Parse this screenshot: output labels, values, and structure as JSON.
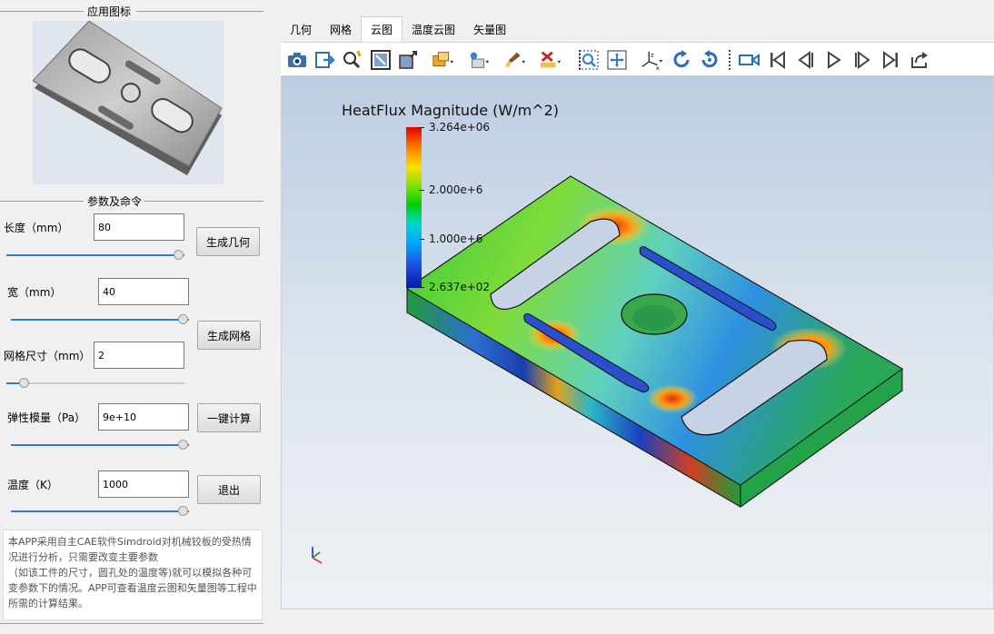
{
  "left": {
    "icon_group_title": "应用图标",
    "params_group_title": "参数及命令",
    "params": {
      "length": {
        "label": "长度（mm）",
        "value": "80",
        "slider": 1.0
      },
      "width": {
        "label": "宽（mm）",
        "value": "40",
        "slider": 1.0
      },
      "mesh": {
        "label": "网格尺寸（mm）",
        "value": "2",
        "slider": 0.1
      },
      "modulus": {
        "label": "弹性模量（Pa）",
        "value": "9e+10",
        "slider": 1.0
      },
      "temperature": {
        "label": "温度（K）",
        "value": "1000",
        "slider": 1.0
      }
    },
    "buttons": {
      "gen_geometry": "生成几何",
      "gen_mesh": "生成网格",
      "compute": "一键计算",
      "exit": "退出"
    },
    "description": "本APP采用自主CAE软件Simdroid对机械铰板的受热情况进行分析，只需要改变主要参数\n（如该工件的尺寸，圆孔处的温度等)就可以模拟各种可变参数下的情况。APP可查看温度云图和矢量图等工程中所需的计算结果。"
  },
  "tabs": [
    "几何",
    "网格",
    "云图",
    "温度云图",
    "矢量图"
  ],
  "active_tab": "云图",
  "toolbar_icons": [
    "camera-icon",
    "export-icon",
    "probe-icon",
    "fit-view-icon",
    "box-view-icon",
    "display-mode-icon",
    "render-mode-icon",
    "brush-icon",
    "clear-icon",
    "zoom-box-icon",
    "pan-icon",
    "axes-icon",
    "rotate-cw-icon",
    "rotate-ccw-icon",
    "video-icon",
    "first-frame-icon",
    "prev-frame-icon",
    "play-icon",
    "next-frame-icon",
    "last-frame-icon",
    "share-icon"
  ],
  "colorbar": {
    "title": "HeatFlux Magnitude (W/m^2)",
    "max_label": "3.264e+06",
    "mid_label": "2.000e+6",
    "low_label": "1.000e+6",
    "min_label": "2.637e+02"
  },
  "colors": {
    "accent": "#2f7ec9",
    "viewport_top": "#bccde2",
    "viewport_bottom": "#eef1f5"
  }
}
